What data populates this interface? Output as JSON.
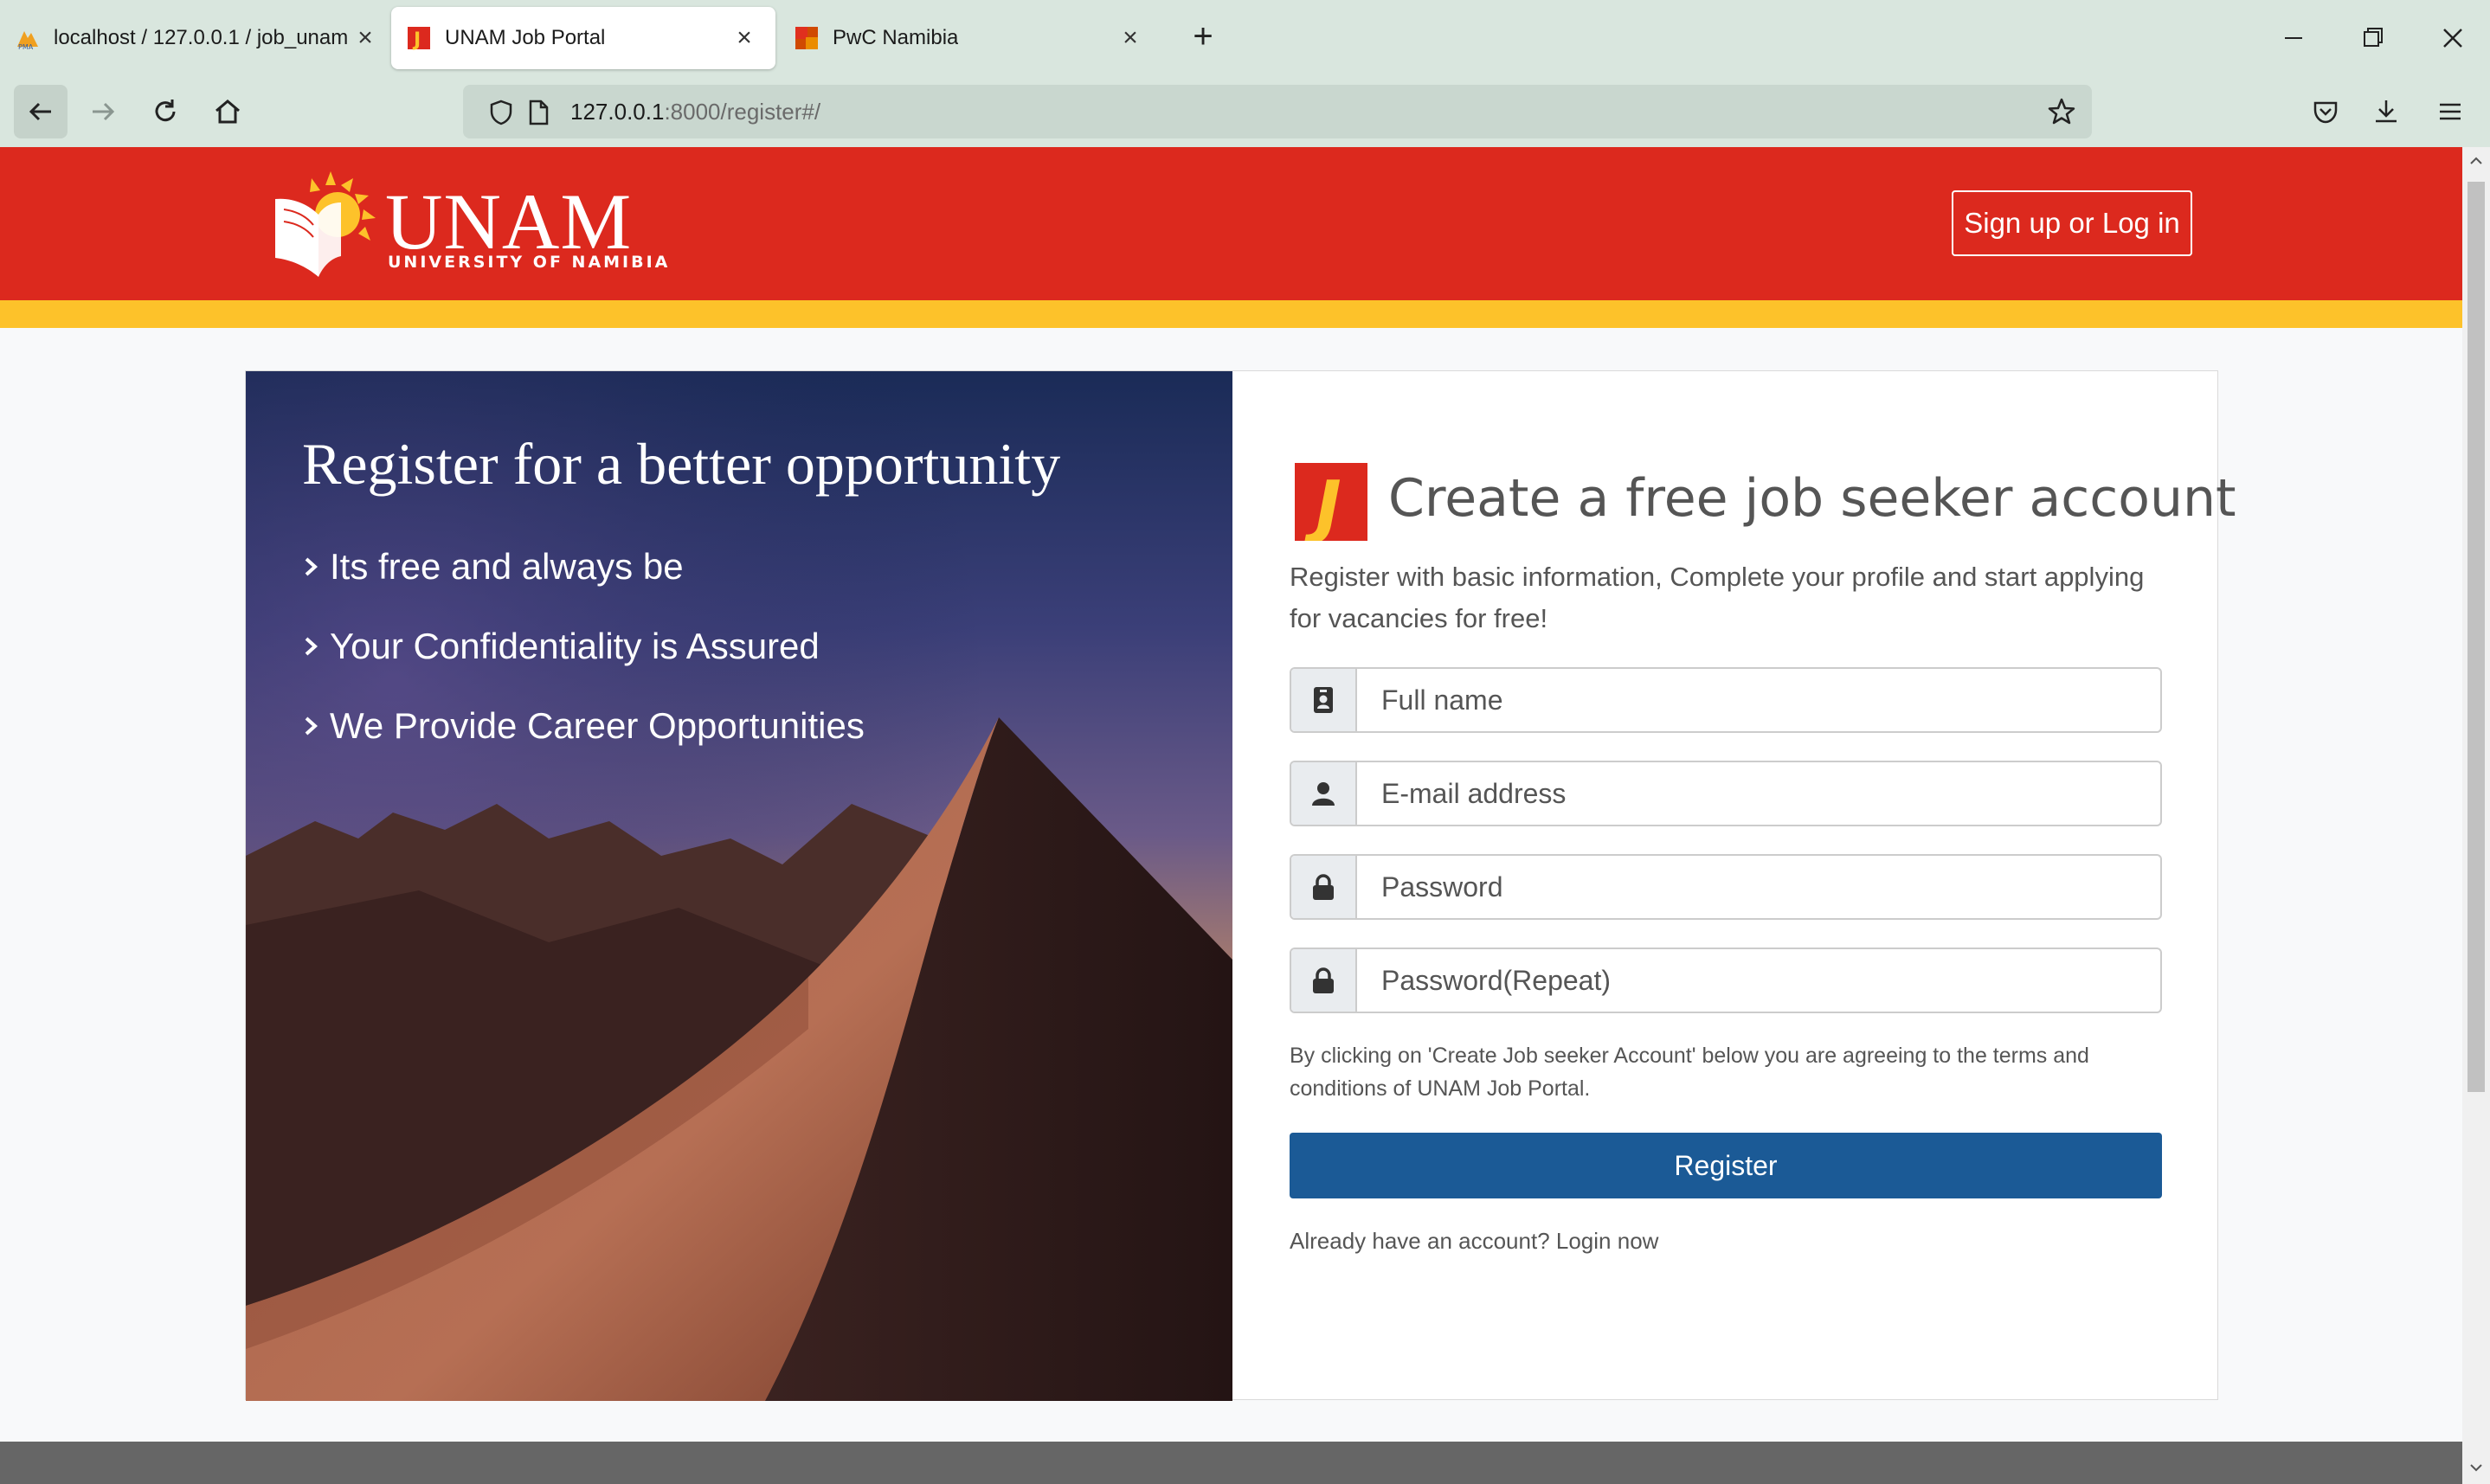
{
  "browser": {
    "tabs": [
      {
        "title": "localhost / 127.0.0.1 / job_unam",
        "favicon": "phpmyadmin-icon",
        "active": false
      },
      {
        "title": "UNAM Job Portal",
        "favicon": "unam-j-icon",
        "active": true
      },
      {
        "title": "PwC Namibia",
        "favicon": "pwc-icon",
        "active": false
      }
    ],
    "url_host": "127.0.0.1",
    "url_rest": ":8000/register#/"
  },
  "header": {
    "logo_title": "UNAM",
    "logo_subtitle": "UNIVERSITY OF NAMIBIA",
    "signup_label": "Sign up or Log in"
  },
  "hero": {
    "title": "Register for a better opportunity",
    "points": [
      "Its free and always be",
      "Your Confidentiality is Assured",
      "We Provide Career Opportunities"
    ]
  },
  "form": {
    "title": "Create a free job seeker account",
    "description": "Register with basic information, Complete your profile and start applying for vacancies for free!",
    "fields": {
      "full_name": {
        "placeholder": "Full name",
        "icon": "id-badge-icon"
      },
      "email": {
        "placeholder": "E-mail address",
        "icon": "user-icon"
      },
      "password": {
        "placeholder": "Password",
        "icon": "lock-icon"
      },
      "password_repeat": {
        "placeholder": "Password(Repeat)",
        "icon": "lock-icon"
      }
    },
    "terms": "By clicking on 'Create Job seeker Account' below you are agreeing to the terms and conditions of UNAM Job Portal.",
    "register_label": "Register",
    "login_prompt": "Already have an account?",
    "login_link": "Login now"
  },
  "colors": {
    "header_red": "#dc291e",
    "accent_yellow": "#fdc22a",
    "button_blue": "#1b5a96",
    "chrome_green": "#d9e6de"
  }
}
